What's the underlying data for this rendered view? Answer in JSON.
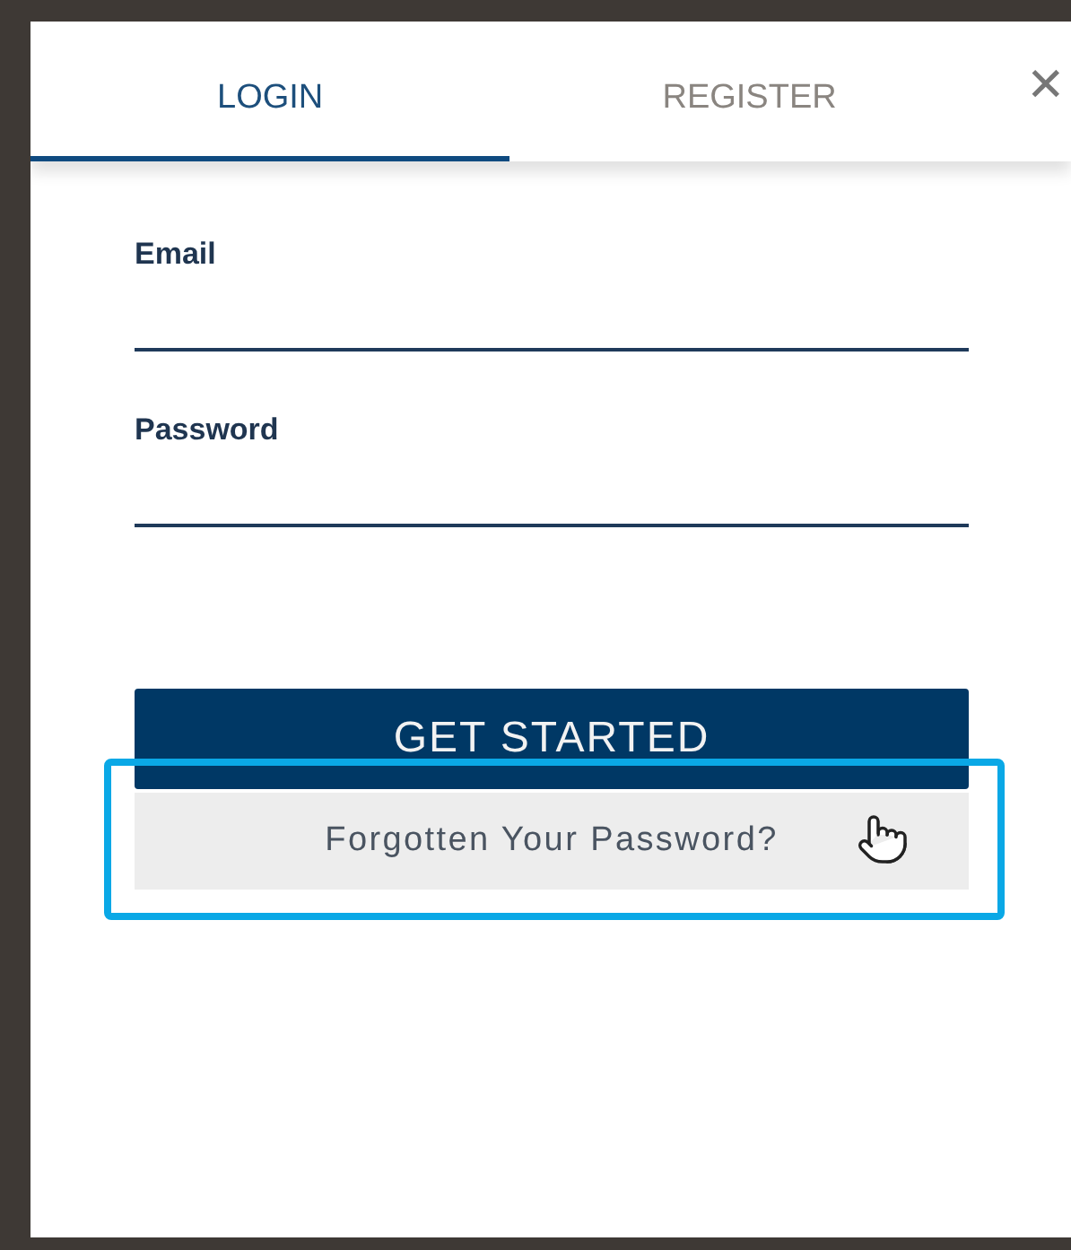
{
  "tabs": [
    {
      "label": "LOGIN",
      "selected": true
    },
    {
      "label": "REGISTER",
      "selected": false
    }
  ],
  "close": {
    "glyph": "✕"
  },
  "fields": [
    {
      "label": "Email"
    },
    {
      "label": "Password"
    }
  ],
  "submit": {
    "label": "GET STARTED"
  },
  "forgot_password": {
    "label": "Forgotten Your Password?",
    "highlighted": true
  }
}
